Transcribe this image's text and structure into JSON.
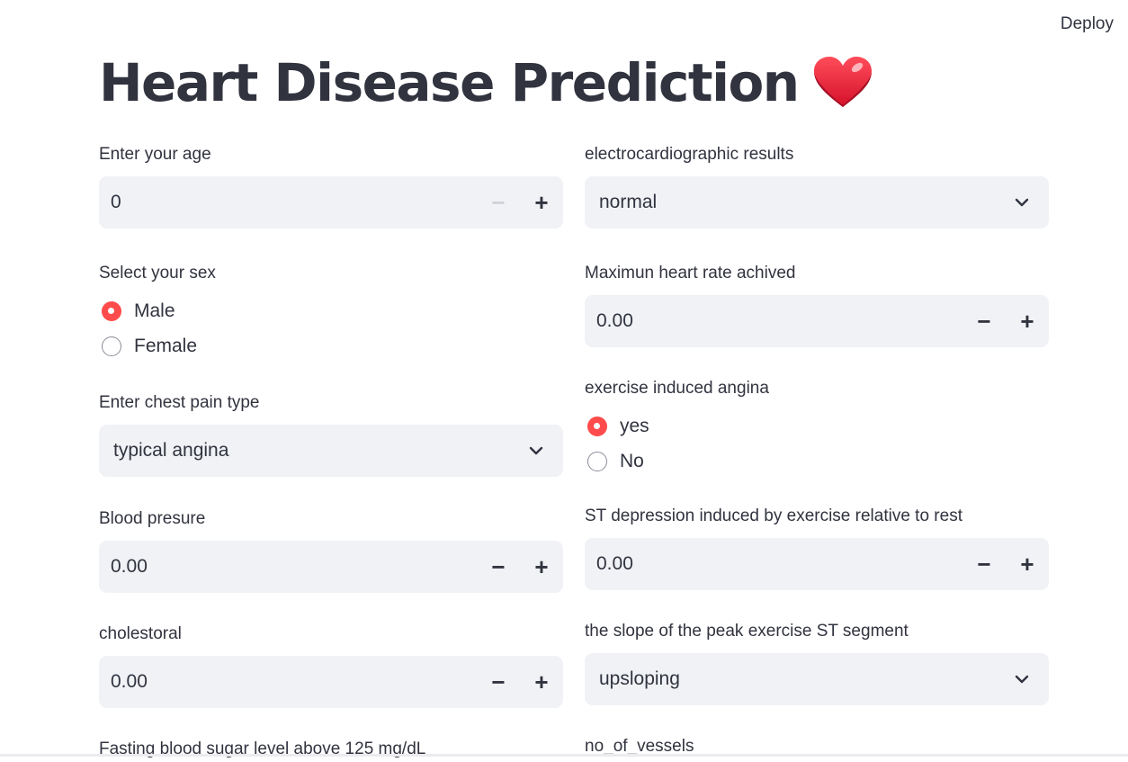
{
  "header": {
    "deploy_label": "Deploy"
  },
  "title": {
    "text": "Heart Disease Prediction",
    "emoji_icon": "red-heart-icon"
  },
  "left": {
    "age": {
      "label": "Enter your age",
      "value": "0"
    },
    "sex": {
      "label": "Select your sex",
      "options": [
        "Male",
        "Female"
      ],
      "selected": "Male"
    },
    "chest_pain": {
      "label": "Enter chest pain type",
      "value": "typical angina"
    },
    "blood_pressure": {
      "label": "Blood presure",
      "value": "0.00"
    },
    "cholesterol": {
      "label": "cholestoral",
      "value": "0.00"
    },
    "fasting_sugar": {
      "label": "Fasting blood sugar level above 125 mg/dL"
    }
  },
  "right": {
    "ecg": {
      "label": "electrocardiographic results",
      "value": "normal"
    },
    "max_hr": {
      "label": "Maximun heart rate achived",
      "value": "0.00"
    },
    "angina": {
      "label": "exercise induced angina",
      "options": [
        "yes",
        "No"
      ],
      "selected": "yes"
    },
    "st_depression": {
      "label": "ST depression induced by exercise relative to rest",
      "value": "0.00"
    },
    "slope": {
      "label": "the slope of the peak exercise ST segment",
      "value": "upsloping"
    },
    "vessels": {
      "label": "no_of_vessels"
    }
  },
  "stepper": {
    "minus": "−",
    "plus": "+"
  },
  "colors": {
    "accent": "#ff4b4b",
    "field_bg": "#f0f2f6",
    "text": "#31333f"
  }
}
